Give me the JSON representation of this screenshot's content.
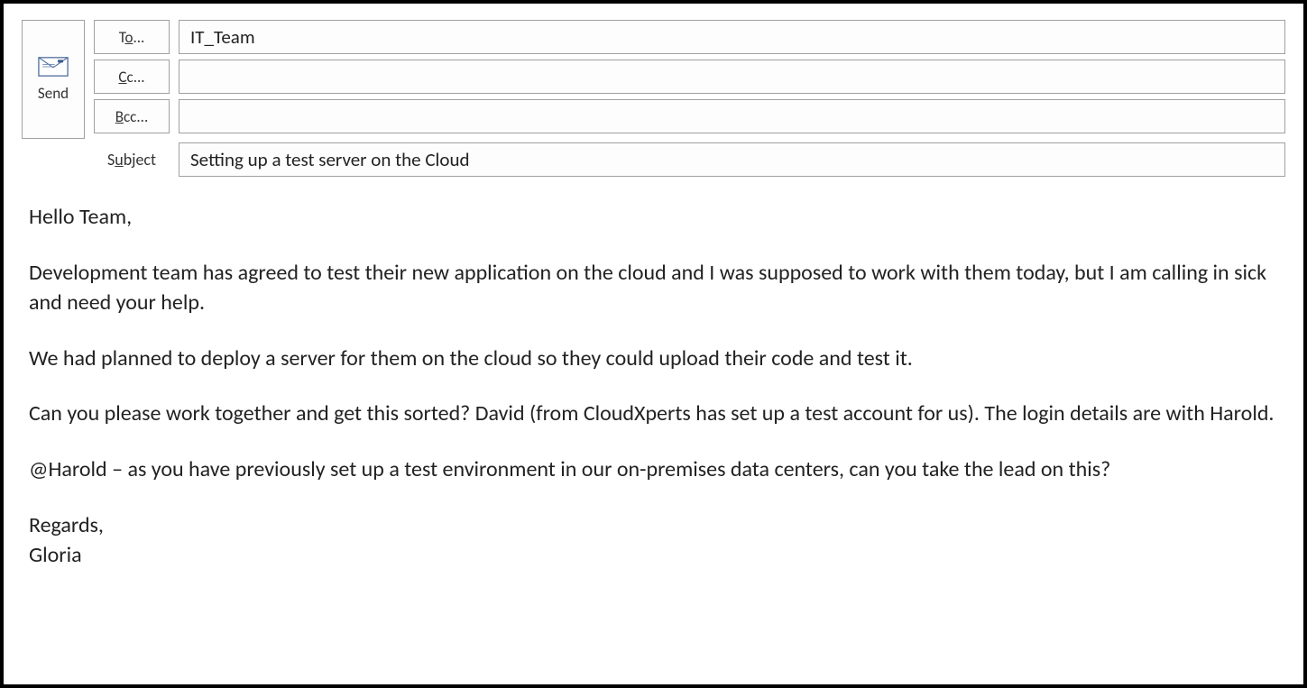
{
  "send": {
    "label": "Send"
  },
  "fields": {
    "to": {
      "label_prefix": "T",
      "label_underline": "o",
      "label_suffix": "...",
      "value": "IT_Team"
    },
    "cc": {
      "label_prefix": "",
      "label_underline": "C",
      "label_suffix": "c...",
      "value": ""
    },
    "bcc": {
      "label_prefix": "",
      "label_underline": "B",
      "label_suffix": "cc...",
      "value": ""
    },
    "subject": {
      "label_prefix": "S",
      "label_underline": "u",
      "label_suffix": "bject",
      "value": "Setting up a test server on the Cloud"
    }
  },
  "body": {
    "greeting": "Hello Team,",
    "p1": "Development team has agreed to test their new application on the cloud and I was supposed to work with them today, but I am calling in sick and need your help.",
    "p2": "We had planned to deploy a server for them on the cloud so they could upload their code and test it.",
    "p3": "Can you please work together and get this sorted? David (from CloudXperts has set up a test account for us). The login details are with Harold.",
    "p4": "@Harold – as you have previously set up a test environment in our on-premises data centers, can you take the lead on this?",
    "signoff": "Regards,",
    "name": "Gloria"
  }
}
